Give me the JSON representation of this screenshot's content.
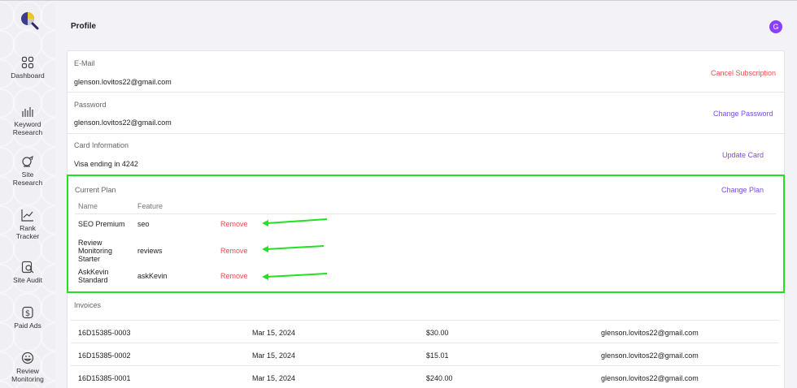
{
  "header": {
    "title": "Profile",
    "avatar_letter": "G",
    "avatar_color": "#8a3ffc"
  },
  "sidebar": {
    "items": [
      {
        "label": "Dashboard",
        "icon": "dashboard-icon"
      },
      {
        "label": "Keyword\nResearch",
        "icon": "keyword-bars-icon"
      },
      {
        "label": "Site\nResearch",
        "icon": "site-research-icon"
      },
      {
        "label": "Rank\nTracker",
        "icon": "rank-chart-icon"
      },
      {
        "label": "Site Audit",
        "icon": "site-audit-icon"
      },
      {
        "label": "Paid Ads",
        "icon": "dollar-icon"
      },
      {
        "label": "Review\nMonitoring",
        "icon": "review-face-icon"
      }
    ]
  },
  "email": {
    "label": "E-Mail",
    "value": "glenson.lovitos22@gmail.com",
    "action": "Cancel Subscription"
  },
  "password": {
    "label": "Password",
    "value": "glenson.lovitos22@gmail.com",
    "action": "Change Password"
  },
  "card": {
    "label": "Card Information",
    "value": "Visa ending in 4242",
    "action": "Update Card"
  },
  "plan": {
    "label": "Current Plan",
    "action": "Change Plan",
    "col_name": "Name",
    "col_feature": "Feature",
    "rows": [
      {
        "name": "SEO Premium",
        "feature": "seo",
        "remove": "Remove"
      },
      {
        "name": "Review Monitoring Starter",
        "feature": "reviews",
        "remove": "Remove"
      },
      {
        "name": "AskKevin Standard",
        "feature": "askKevin",
        "remove": "Remove"
      }
    ],
    "highlight_color": "#22e022"
  },
  "invoices": {
    "label": "Invoices",
    "rows": [
      {
        "id": "16D15385-0003",
        "date": "Mar 15, 2024",
        "amount": "$30.00",
        "email": "glenson.lovitos22@gmail.com"
      },
      {
        "id": "16D15385-0002",
        "date": "Mar 15, 2024",
        "amount": "$15.01",
        "email": "glenson.lovitos22@gmail.com"
      },
      {
        "id": "16D15385-0001",
        "date": "Mar 15, 2024",
        "amount": "$240.00",
        "email": "glenson.lovitos22@gmail.com"
      }
    ]
  },
  "colors": {
    "accent": "#7a4ce0",
    "danger": "#e45050"
  }
}
